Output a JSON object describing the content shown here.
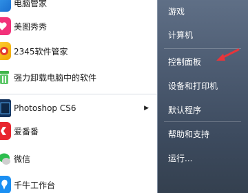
{
  "left_menu": {
    "items": [
      {
        "label": "电脑管家",
        "icon": "tencent-pc-manager-icon"
      },
      {
        "label": "美图秀秀",
        "icon": "meitu-icon"
      },
      {
        "label": "2345软件管家",
        "icon": "2345-software-manager-icon"
      },
      {
        "label": "强力卸载电脑中的软件",
        "icon": "uninstaller-icon"
      },
      {
        "label": "Photoshop CS6",
        "icon": "photoshop-icon"
      },
      {
        "label": "爱番番",
        "icon": "aifanfan-icon"
      },
      {
        "label": "微信",
        "icon": "wechat-icon"
      },
      {
        "label": "千牛工作台",
        "icon": "qianniu-icon"
      }
    ],
    "submenu_arrow": "▶"
  },
  "right_menu": {
    "items": [
      {
        "label": "游戏"
      },
      {
        "label": "计算机"
      },
      {
        "label": "控制面板"
      },
      {
        "label": "设备和打印机"
      },
      {
        "label": "默认程序"
      },
      {
        "label": "帮助和支持"
      },
      {
        "label": "运行..."
      }
    ]
  },
  "colors": {
    "right_panel": "#4d5c72",
    "annotation_arrow": "#e8343a"
  }
}
